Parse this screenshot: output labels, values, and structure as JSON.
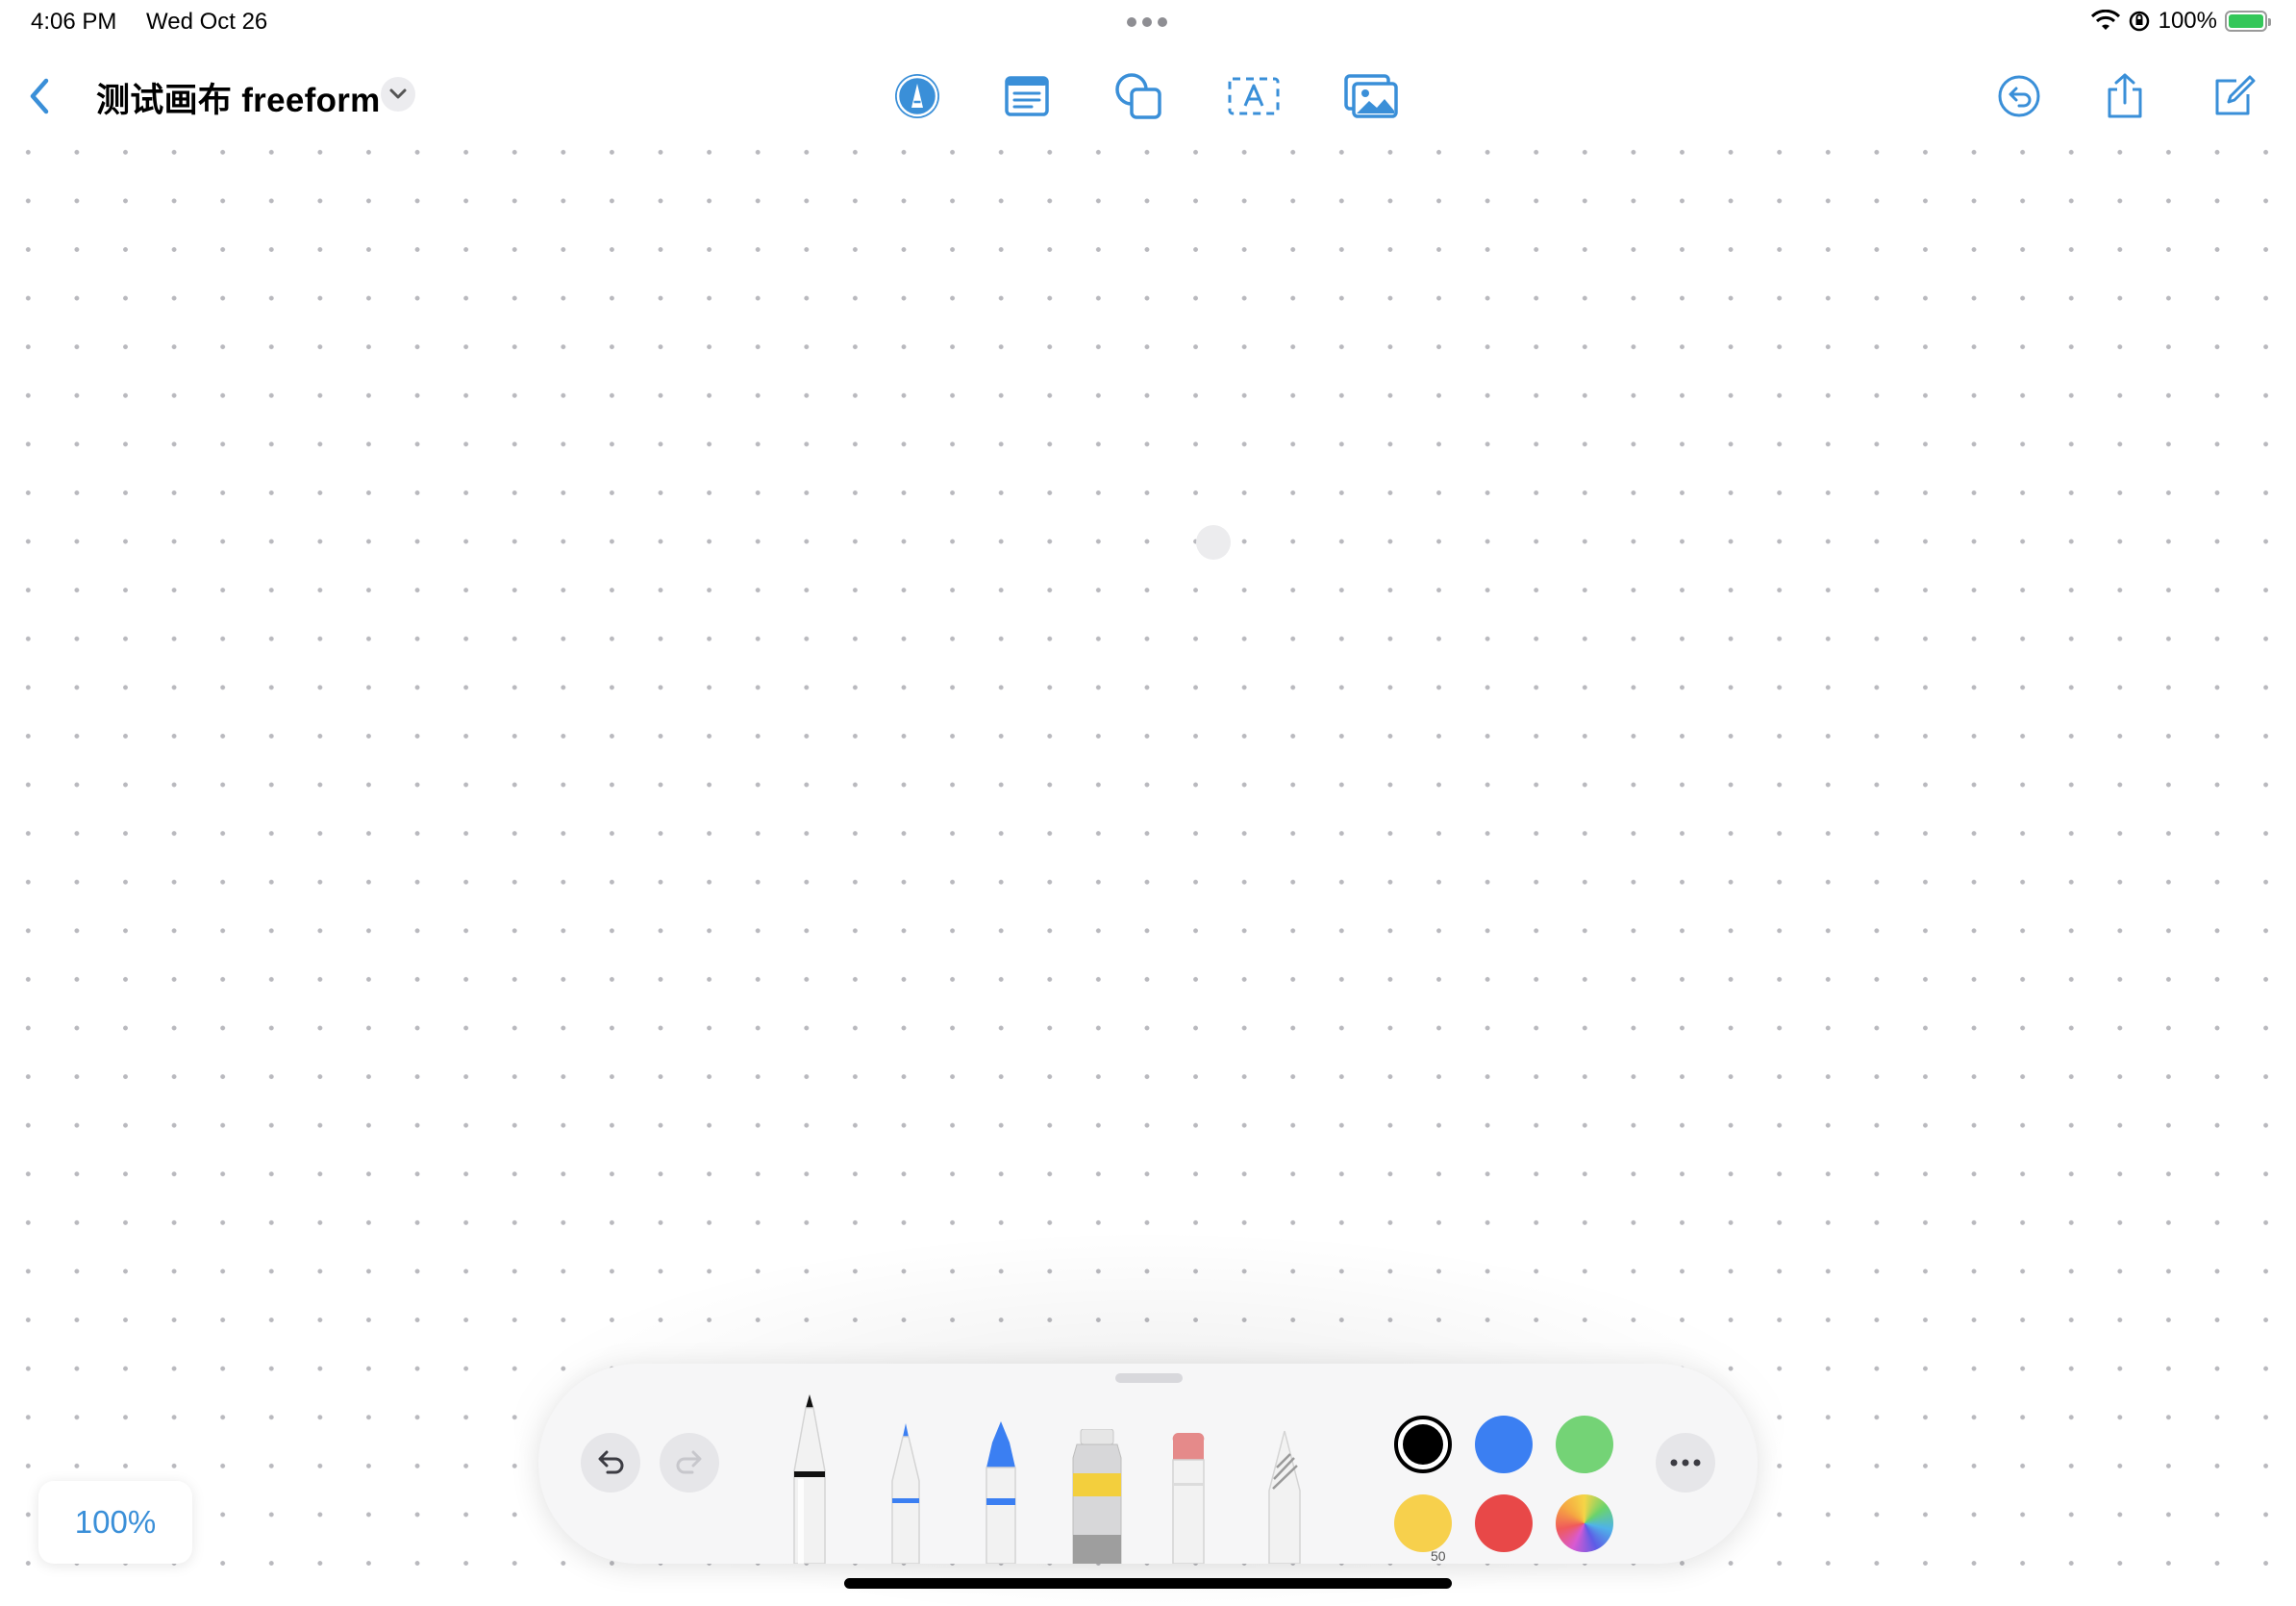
{
  "status": {
    "time": "4:06 PM",
    "date": "Wed Oct 26",
    "battery": "100%",
    "battery_level": 1.0
  },
  "nav": {
    "title": "测试画布 freeform"
  },
  "toolbar": {
    "icons": [
      "pen-markup-icon",
      "sticky-note-icon",
      "shapes-icon",
      "text-box-icon",
      "media-icon"
    ],
    "right_icons": [
      "history-icon",
      "share-icon",
      "compose-icon"
    ]
  },
  "zoom": {
    "label": "100%"
  },
  "palette": {
    "tools": [
      "pen",
      "monoline-pencil",
      "marker",
      "paint-bottle",
      "eraser",
      "lasso"
    ],
    "pencil_width_label": "50",
    "colors": {
      "black": "#000000",
      "blue": "#3b7ff2",
      "green": "#74d376",
      "yellow": "#f7d04c",
      "red": "#e84848"
    },
    "selected_color": "black"
  },
  "colors": {
    "accent": "#3a8fd8",
    "canvas_dot": "#b9b9be"
  }
}
